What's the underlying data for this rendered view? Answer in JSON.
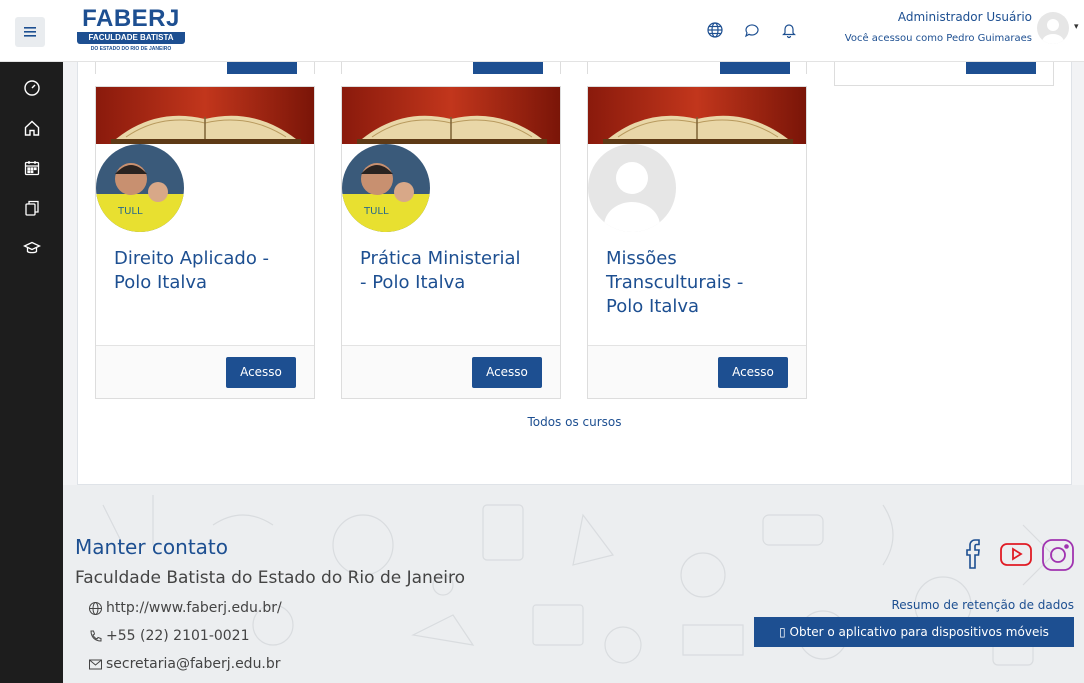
{
  "header": {
    "logo_main": "FABERJ",
    "logo_band": "FACULDADE BATISTA",
    "logo_sub": "DO ESTADO DO RIO DE JANEIRO",
    "user_name": "Administrador Usuário",
    "user_sub": "Você acessou como Pedro Guimaraes",
    "icons": [
      "menu-icon",
      "globe-icon",
      "chat-icon",
      "bell-icon"
    ]
  },
  "sidebar": {
    "icons": [
      "dashboard-icon",
      "home-icon",
      "calendar-icon",
      "files-icon",
      "graduation-cap-icon"
    ]
  },
  "courses": [
    {
      "title_line1": "Direito Aplicado -",
      "title_line2": "Polo Italva",
      "title_line3": "",
      "button": "Acesso",
      "avatar": "photo"
    },
    {
      "title_line1": "Prática Ministerial",
      "title_line2": "- Polo Italva",
      "title_line3": "",
      "button": "Acesso",
      "avatar": "photo"
    },
    {
      "title_line1": "Missões",
      "title_line2": "Transculturais -",
      "title_line3": "Polo Italva",
      "button": "Acesso",
      "avatar": "default"
    }
  ],
  "all_courses_link": "Todos os cursos",
  "footer": {
    "contact_title": "Manter contato",
    "org_name": "Faculdade Batista do Estado do Rio de Janeiro",
    "website": "http://www.faberj.edu.br/",
    "phone": "+55 (22) 2101-0021",
    "email": "secretaria@faberj.edu.br",
    "retention_link": "Resumo de retenção de dados",
    "app_button": "Obter o aplicativo para dispositivos móveis",
    "social": [
      "facebook-icon",
      "youtube-icon",
      "instagram-icon"
    ]
  },
  "colors": {
    "primary": "#1d4f91",
    "drawer": "#1d1d1d",
    "instagram": "#a033b0"
  }
}
